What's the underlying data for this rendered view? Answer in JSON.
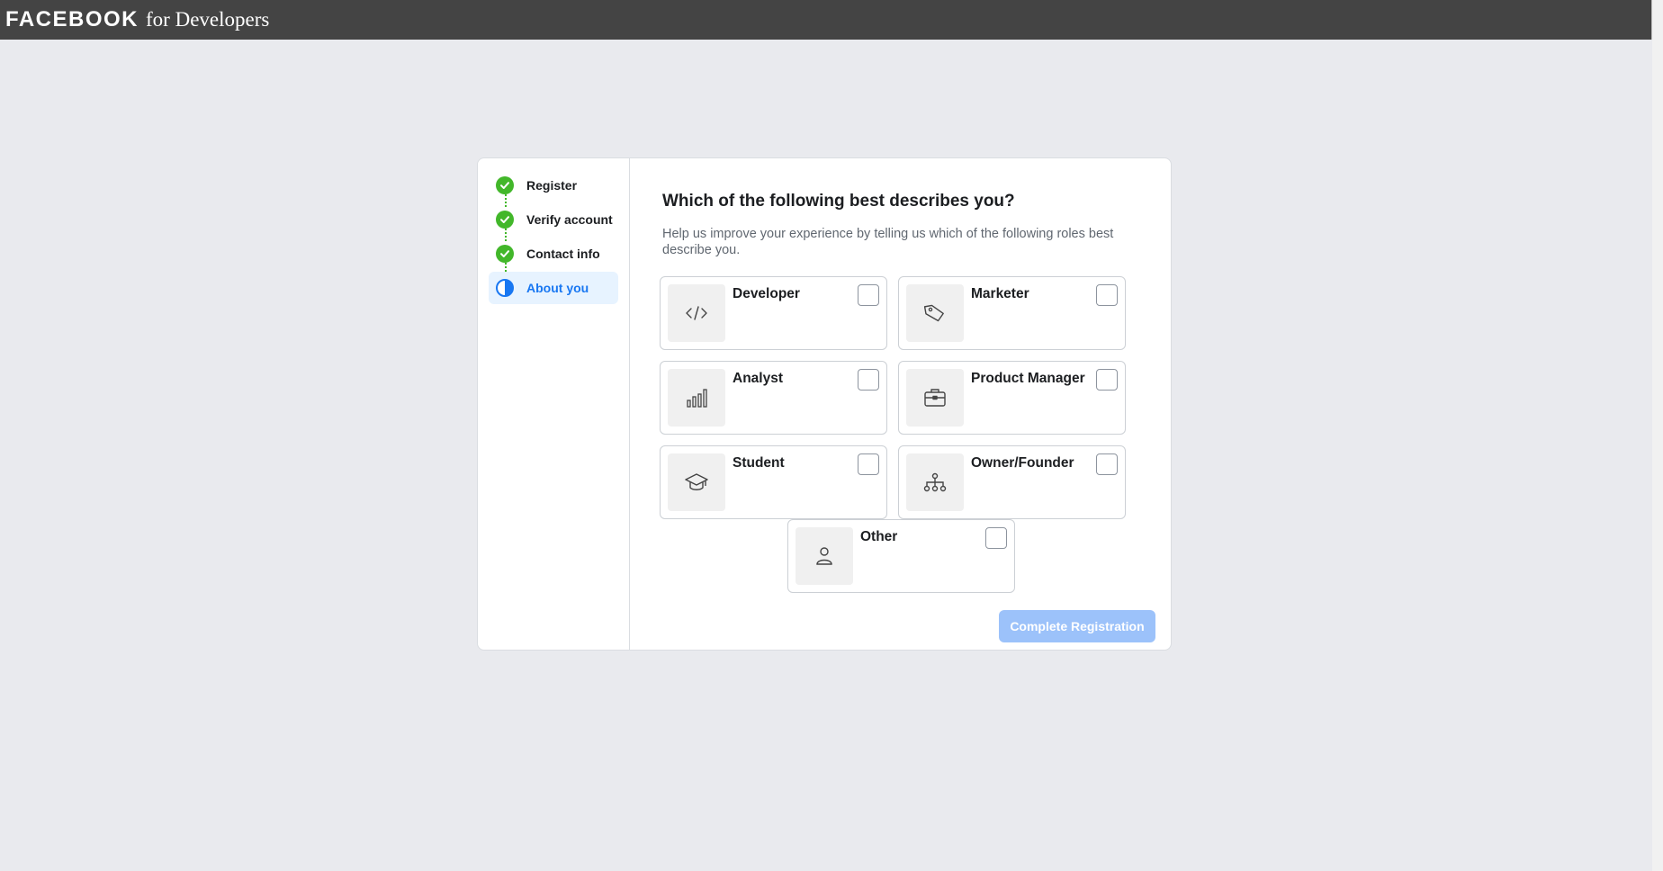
{
  "header": {
    "brand_strong": "FACEBOOK",
    "brand_light": "for Developers"
  },
  "steps": [
    {
      "label": "Register",
      "status": "complete"
    },
    {
      "label": "Verify account",
      "status": "complete"
    },
    {
      "label": "Contact info",
      "status": "complete"
    },
    {
      "label": "About you",
      "status": "in-progress"
    }
  ],
  "main": {
    "title": "Which of the following best describes you?",
    "subtitle": "Help us improve your experience by telling us which of the following roles best describe you.",
    "roles": [
      {
        "label": "Developer",
        "icon": "code-icon",
        "checked": false
      },
      {
        "label": "Marketer",
        "icon": "tag-icon",
        "checked": false
      },
      {
        "label": "Analyst",
        "icon": "bar-chart-icon",
        "checked": false
      },
      {
        "label": "Product Manager",
        "icon": "briefcase-icon",
        "checked": false
      },
      {
        "label": "Student",
        "icon": "graduation-cap-icon",
        "checked": false
      },
      {
        "label": "Owner/Founder",
        "icon": "org-chart-icon",
        "checked": false
      },
      {
        "label": "Other",
        "icon": "person-icon",
        "checked": false
      }
    ],
    "complete_button": "Complete Registration"
  },
  "colors": {
    "header_bg": "#444444",
    "page_bg": "#e9eaee",
    "step_complete": "#42b72a",
    "accent": "#1877f2",
    "button_disabled": "#9cc2fa"
  }
}
